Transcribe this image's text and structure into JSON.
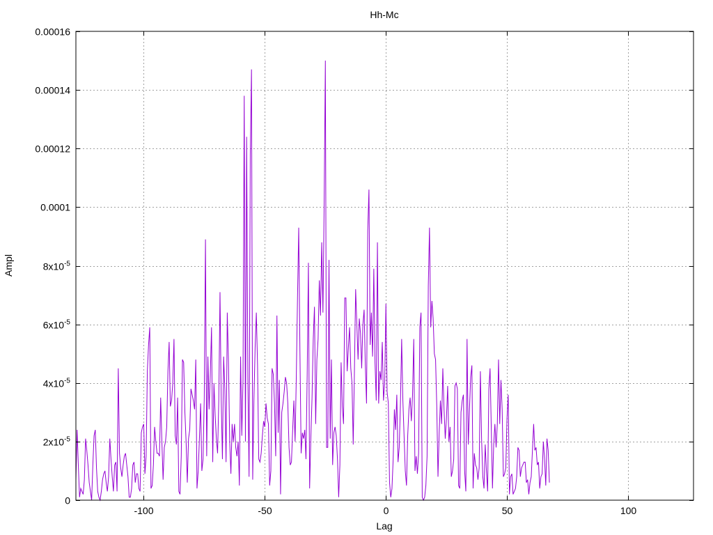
{
  "chart_data": {
    "type": "line",
    "title": "Hh-Mc",
    "xlabel": "Lag",
    "ylabel": "Ampl",
    "xlim": [
      -128,
      127
    ],
    "ylim": [
      0,
      0.00016
    ],
    "grid": true,
    "x_ticks": [
      {
        "value": -100,
        "label": "-100"
      },
      {
        "value": -50,
        "label": "-50"
      },
      {
        "value": 0,
        "label": "0"
      },
      {
        "value": 50,
        "label": "50"
      },
      {
        "value": 100,
        "label": "100"
      }
    ],
    "y_ticks": [
      {
        "value": 0,
        "label": "0",
        "exp": ""
      },
      {
        "value": 2e-05,
        "label": "2x10",
        "exp": "-5"
      },
      {
        "value": 4e-05,
        "label": "4x10",
        "exp": "-5"
      },
      {
        "value": 6e-05,
        "label": "6x10",
        "exp": "-5"
      },
      {
        "value": 8e-05,
        "label": "8x10",
        "exp": "-5"
      },
      {
        "value": 0.0001,
        "label": "0.0001",
        "exp": ""
      },
      {
        "value": 0.00012,
        "label": "0.00012",
        "exp": ""
      },
      {
        "value": 0.00014,
        "label": "0.00014",
        "exp": ""
      },
      {
        "value": 0.00016,
        "label": "0.00016",
        "exp": ""
      }
    ],
    "series": [
      {
        "color": "#9400d3",
        "x_start": -128,
        "x_step": 0.5,
        "values": [
          7e-06,
          2.4e-05,
          1.2e-05,
          1e-06,
          4e-06,
          3e-06,
          2e-06,
          7e-06,
          2.1e-05,
          1.7e-05,
          1.2e-05,
          6e-06,
          3e-06,
          0.0,
          1.2e-05,
          2.2e-05,
          2.4e-05,
          1.1e-05,
          3e-06,
          1e-06,
          0.0,
          3e-06,
          7e-06,
          9e-06,
          1e-05,
          6e-06,
          3e-06,
          8e-06,
          2.1e-05,
          1.4e-05,
          8e-06,
          3e-06,
          1.2e-05,
          1.3e-05,
          3e-06,
          4.5e-05,
          1.6e-05,
          1.1e-05,
          8e-06,
          1.2e-05,
          1.5e-05,
          1.6e-05,
          1.2e-05,
          8e-06,
          1e-06,
          1e-06,
          4e-06,
          1.2e-05,
          1.3e-05,
          6e-06,
          9e-06,
          9e-06,
          4e-06,
          3e-06,
          2.3e-05,
          2.5e-05,
          2.6e-05,
          9e-06,
          1.5e-05,
          4.4e-05,
          5.3e-05,
          5.9e-05,
          4e-06,
          5e-06,
          1.2e-05,
          2.5e-05,
          2e-05,
          1.6e-05,
          1.6e-05,
          1.5e-05,
          3.5e-05,
          2e-05,
          7e-06,
          1.8e-05,
          2e-05,
          2.5e-05,
          4.4e-05,
          5.4e-05,
          3.2e-05,
          3.4e-05,
          4e-05,
          5.5e-05,
          2.2e-05,
          1.9e-05,
          3.5e-05,
          3e-06,
          2e-06,
          1.5e-05,
          4.8e-05,
          4.7e-05,
          3e-05,
          2e-05,
          6e-06,
          2.1e-05,
          2.4e-05,
          3.8e-05,
          3.6e-05,
          3.4e-05,
          3.1e-05,
          4.8e-05,
          4e-06,
          1e-05,
          2.1e-05,
          3.3e-05,
          1e-05,
          1.4e-05,
          3.5e-05,
          8.9e-05,
          1.5e-05,
          4.9e-05,
          3.1e-05,
          4.3e-05,
          5.9e-05,
          1.3e-05,
          4e-05,
          2.9e-05,
          2.1e-05,
          1.6e-05,
          3.4e-05,
          7.1e-05,
          3.4e-05,
          1.4e-05,
          4.9e-05,
          3.8e-05,
          1.3e-05,
          6.4e-05,
          4.7e-05,
          2e-05,
          9e-06,
          2.6e-05,
          2e-05,
          2.6e-05,
          1.8e-05,
          1.5e-05,
          2e-05,
          5e-06,
          4.9e-05,
          2.2e-05,
          4.1e-05,
          0.000138,
          2e-05,
          0.000124,
          4.2e-05,
          8e-06,
          0.000118,
          0.000147,
          7e-06,
          3.4e-05,
          5.2e-05,
          6.4e-05,
          4.6e-05,
          1.4e-05,
          1.3e-05,
          1.6e-05,
          2.2e-05,
          2.7e-05,
          2.5e-05,
          3.3e-05,
          2.8e-05,
          2.6e-05,
          5e-06,
          1e-05,
          4.5e-05,
          4.3e-05,
          3.3e-05,
          1.5e-05,
          6.3e-05,
          2.3e-05,
          4.1e-05,
          2e-06,
          3e-05,
          3.3e-05,
          3.7e-05,
          4.2e-05,
          4e-05,
          3.3e-05,
          1.8e-05,
          1.2e-05,
          1.3e-05,
          2.4e-05,
          3.4e-05,
          2e-05,
          4.2e-05,
          6.9e-05,
          9.3e-05,
          5.1e-05,
          1.6e-05,
          2.3e-05,
          2.1e-05,
          2.4e-05,
          1.4e-05,
          4.3e-05,
          8.1e-05,
          4e-06,
          2.1e-05,
          3.5e-05,
          5.5e-05,
          6.6e-05,
          2.6e-05,
          4.8e-05,
          5.5e-05,
          7.5e-05,
          6.3e-05,
          8.8e-05,
          6.4e-05,
          0.000101,
          0.00015,
          1.8e-05,
          1.8e-05,
          8.2e-05,
          2.1e-05,
          4.8e-05,
          1.2e-05,
          2.3e-05,
          2.5e-05,
          2.2e-05,
          1.4e-05,
          1e-06,
          1.2e-05,
          4.7e-05,
          3.2e-05,
          2.6e-05,
          6.9e-05,
          6.9e-05,
          4.4e-05,
          5.2e-05,
          5.9e-05,
          4.5e-05,
          4e-05,
          1.9e-05,
          4.4e-05,
          7.2e-05,
          6e-05,
          4.8e-05,
          6.2e-05,
          5.7e-05,
          4.5e-05,
          6e-05,
          6.5e-05,
          4.6e-05,
          3.3e-05,
          9.2e-05,
          0.000106,
          5.3e-05,
          6.4e-05,
          4.9e-05,
          7.9e-05,
          4.7e-05,
          3.4e-05,
          8.8e-05,
          3.3e-05,
          4.4e-05,
          4.1e-05,
          5.4e-05,
          3.4e-05,
          4e-05,
          6.7e-05,
          3.7e-05,
          3.3e-05,
          6e-06,
          1e-06,
          4e-06,
          1.4e-05,
          3.1e-05,
          2.4e-05,
          3.6e-05,
          1.3e-05,
          1.8e-05,
          3.3e-05,
          5.5e-05,
          3.4e-05,
          2.2e-05,
          1e-05,
          5e-06,
          2.2e-05,
          3.1e-05,
          3.5e-05,
          2.7e-05,
          3.6e-05,
          5.5e-05,
          1e-05,
          1.5e-05,
          9e-06,
          1.6e-05,
          5.9e-05,
          6.4e-05,
          1e-06,
          0.0,
          1e-06,
          5e-06,
          1.5e-05,
          7.3e-05,
          9.3e-05,
          5.9e-05,
          6.8e-05,
          6.2e-05,
          5e-05,
          4.8e-05,
          3.2e-05,
          8e-06,
          2.3e-05,
          3.4e-05,
          2.6e-05,
          4.5e-05,
          3.1e-05,
          2.1e-05,
          2.8e-05,
          3.9e-05,
          2e-05,
          2.5e-05,
          8e-06,
          1e-05,
          1.4e-05,
          3.9e-05,
          4e-05,
          3.8e-05,
          5e-06,
          4e-06,
          3e-05,
          3.4e-05,
          3.6e-05,
          1e-05,
          3e-06,
          5.5e-05,
          1.9e-05,
          3.1e-05,
          4.2e-05,
          4.6e-05,
          4e-06,
          1.6e-05,
          1.2e-05,
          1.1e-05,
          7e-06,
          1.1e-05,
          4.4e-05,
          2.1e-05,
          8e-06,
          4e-06,
          1.9e-05,
          1e-05,
          3e-06,
          3.8e-05,
          4.5e-05,
          2.5e-05,
          4e-06,
          1.9e-05,
          2.6e-05,
          1.8e-05,
          2.6e-05,
          4.8e-05,
          2.6e-05,
          4.1e-05,
          3.1e-05,
          8e-06,
          9e-06,
          1.1e-05,
          2.8e-05,
          3.6e-05,
          2e-06,
          8e-06,
          9e-06,
          2e-06,
          3e-06,
          4e-06,
          8e-06,
          1.8e-05,
          1.7e-05,
          8e-06,
          1.1e-05,
          1.2e-05,
          1.3e-05,
          1.3e-05,
          6e-06,
          7e-06,
          2e-06,
          6e-06,
          8e-06,
          1.7e-05,
          2.6e-05,
          1.7e-05,
          1.8e-05,
          1.2e-05,
          1.3e-05,
          4e-06,
          8e-06,
          9e-06,
          2e-05,
          1.4e-05,
          5e-06,
          2.1e-05,
          1.7e-05,
          6e-06
        ]
      }
    ]
  }
}
